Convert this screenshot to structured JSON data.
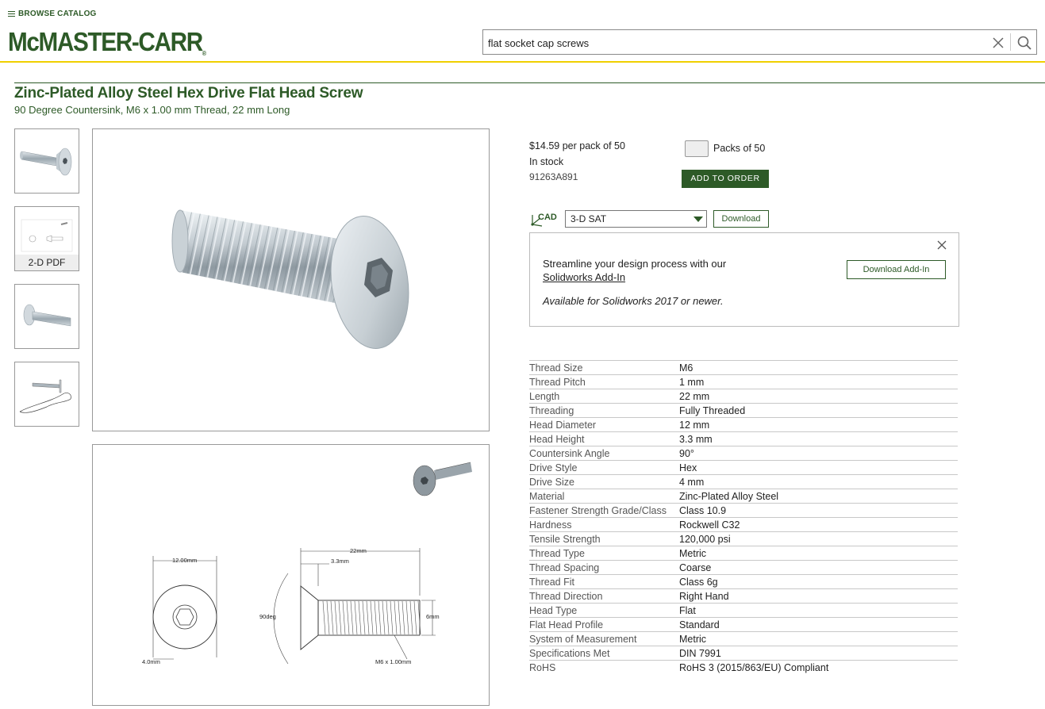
{
  "header": {
    "browse_label": "BROWSE CATALOG",
    "logo_text": "McMASTER-CARR",
    "logo_mark": "®",
    "search_value": "flat socket cap screws"
  },
  "product": {
    "title": "Zinc-Plated Alloy Steel Hex Drive Flat Head Screw",
    "subtitle": "90 Degree Countersink, M6 x 1.00 mm Thread, 22 mm Long"
  },
  "thumbnails": [
    {
      "icon": "screw-photo-icon"
    },
    {
      "icon": "pdf-drawing-icon",
      "caption": "2-D PDF"
    },
    {
      "icon": "screw-angle-photo-icon"
    },
    {
      "icon": "screw-installed-icon"
    }
  ],
  "drawing": {
    "head_dia": "12.00mm",
    "length": "22mm",
    "head_height": "3.3mm",
    "angle": "90deg",
    "dia": "6mm",
    "drive": "4.0mm",
    "thread": "M6 x 1.00mm"
  },
  "purchase": {
    "price": "$14.59 per pack of 50",
    "stock": "In stock",
    "part_number": "91263A891",
    "packs_label": "Packs of 50",
    "add_label": "ADD TO ORDER"
  },
  "cad": {
    "icon_label": "CAD",
    "format": "3-D SAT",
    "download_label": "Download"
  },
  "addin": {
    "text": "Streamline your design process with our",
    "link": "Solidworks Add-In",
    "note": "Available for Solidworks 2017 or newer.",
    "button": "Download Add-In"
  },
  "specs": [
    {
      "k": "Thread Size",
      "v": "M6"
    },
    {
      "k": "Thread Pitch",
      "v": "1 mm"
    },
    {
      "k": "Length",
      "v": "22 mm"
    },
    {
      "k": "Threading",
      "v": "Fully Threaded"
    },
    {
      "k": "Head Diameter",
      "v": "12 mm"
    },
    {
      "k": "Head Height",
      "v": "3.3 mm"
    },
    {
      "k": "Countersink Angle",
      "v": "90°"
    },
    {
      "k": "Drive Style",
      "v": "Hex"
    },
    {
      "k": "Drive Size",
      "v": "4 mm"
    },
    {
      "k": "Material",
      "v": "Zinc-Plated Alloy Steel"
    },
    {
      "k": "Fastener Strength Grade/Class",
      "v": "Class 10.9"
    },
    {
      "k": "Hardness",
      "v": "Rockwell C32"
    },
    {
      "k": "Tensile Strength",
      "v": "120,000 psi"
    },
    {
      "k": "Thread Type",
      "v": "Metric"
    },
    {
      "k": "Thread Spacing",
      "v": "Coarse"
    },
    {
      "k": "Thread Fit",
      "v": "Class 6g"
    },
    {
      "k": "Thread Direction",
      "v": "Right Hand"
    },
    {
      "k": "Head Type",
      "v": "Flat"
    },
    {
      "k": "Flat Head Profile",
      "v": "Standard"
    },
    {
      "k": "System of Measurement",
      "v": "Metric"
    },
    {
      "k": "Specifications Met",
      "v": "DIN 7991"
    },
    {
      "k": "RoHS",
      "v": "RoHS 3 (2015/863/EU) Compliant"
    }
  ]
}
